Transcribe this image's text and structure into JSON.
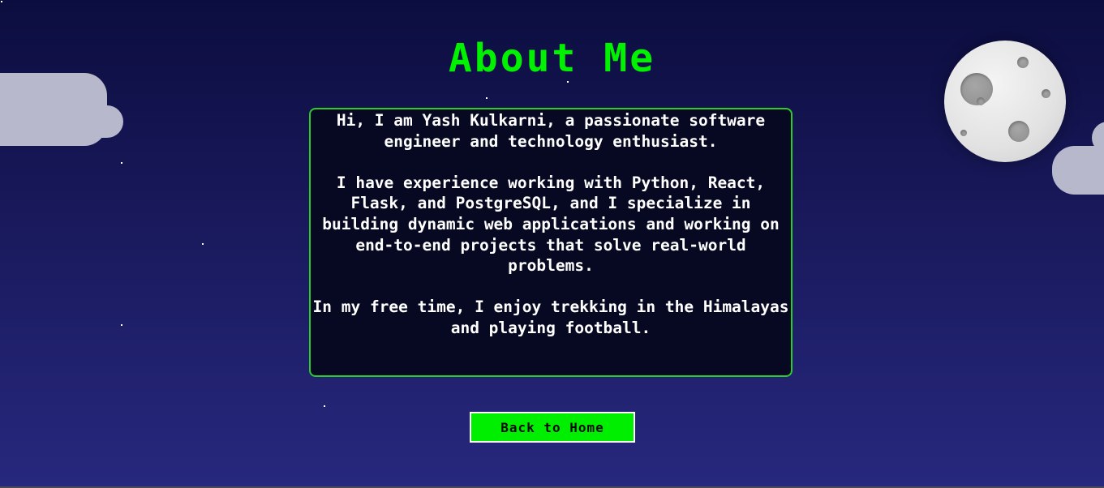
{
  "page": {
    "title": "About Me"
  },
  "about": {
    "paragraphs": [
      "Hi, I am Yash Kulkarni, a passionate software engineer and technology enthusiast.",
      "I have experience working with Python, React, Flask, and PostgreSQL, and I specialize in building dynamic web applications and working on end-to-end projects that solve real-world problems.",
      "In my free time, I enjoy trekking in the Himalayas and playing football."
    ]
  },
  "actions": {
    "back_label": "Back to Home"
  },
  "decor": {
    "moon_icon": "moon-icon",
    "cloud_icon": "cloud-icon",
    "star_icon": "star-icon"
  },
  "colors": {
    "accent_green": "#00f200",
    "button_green": "#00ee00",
    "box_border": "#2dcc2d",
    "background_top": "#0c0d3f",
    "background_bottom": "#27287e",
    "cloud": "#b7b8cc"
  }
}
